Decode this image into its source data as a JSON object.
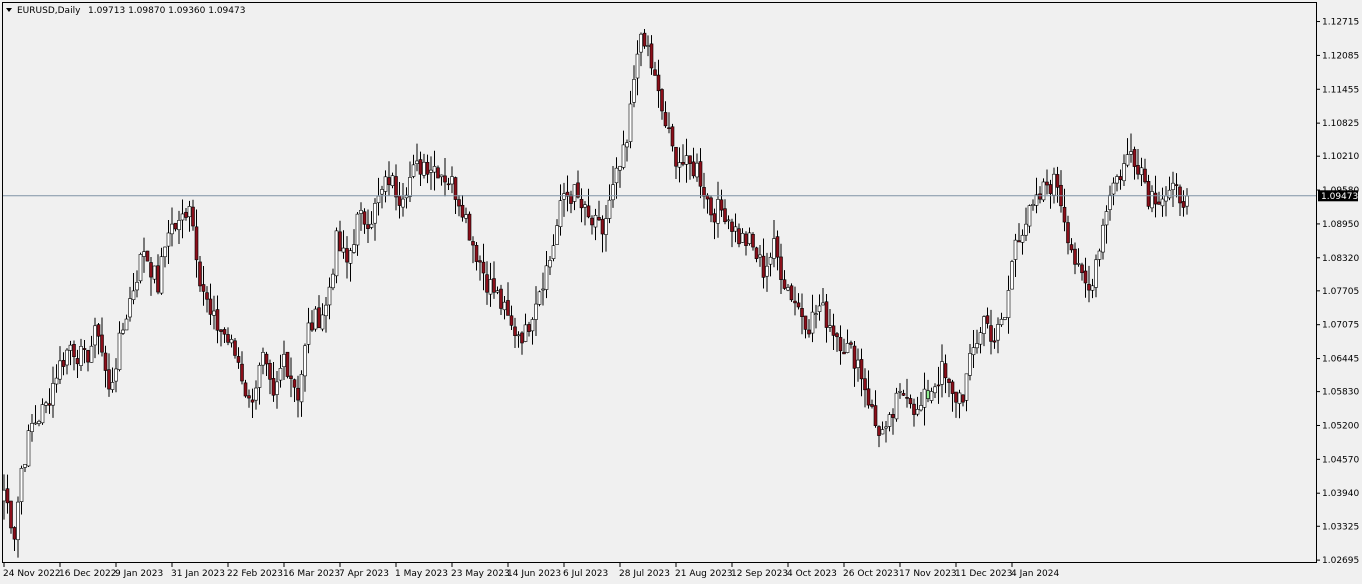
{
  "header": {
    "symbol_label": "EURUSD,Daily",
    "ohlc_label": "1.09713 1.09870 1.09360 1.09473",
    "menu_icon": "triangle-down-icon"
  },
  "price_label": "1.09473",
  "colors": {
    "background": "#f0f0f0",
    "border": "#000000",
    "up_body": "#ffffff",
    "down_body": "#8b0f1a",
    "highlight_up": "#90ee90",
    "candle_outline": "#000000",
    "price_line": "#7f93a5",
    "price_label_bg": "#000000",
    "price_label_text": "#ffffff"
  },
  "chart_data": {
    "type": "candlestick",
    "title": "EURUSD,Daily",
    "ylim": [
      1.0266,
      1.1306
    ],
    "grid": false,
    "y_ticks": [
      "1.12715",
      "1.12085",
      "1.11455",
      "1.10825",
      "1.10210",
      "1.09580",
      "1.08950",
      "1.08320",
      "1.07705",
      "1.07075",
      "1.06445",
      "1.05830",
      "1.05200",
      "1.04570",
      "1.03940",
      "1.03325",
      "1.02695"
    ],
    "x_ticks": [
      "24 Nov 2022",
      "16 Dec 2022",
      "9 Jan 2023",
      "31 Jan 2023",
      "22 Feb 2023",
      "16 Mar 2023",
      "7 Apr 2023",
      "1 May 2023",
      "23 May 2023",
      "14 Jun 2023",
      "6 Jul 2023",
      "28 Jul 2023",
      "21 Aug 2023",
      "12 Sep 2023",
      "4 Oct 2023",
      "26 Oct 2023",
      "17 Nov 2023",
      "11 Dec 2023",
      "4 Jan 2024"
    ],
    "current_price": 1.09473,
    "anchors": [
      [
        0,
        1.04
      ],
      [
        3,
        1.032
      ],
      [
        5,
        1.044
      ],
      [
        8,
        1.052
      ],
      [
        12,
        1.0555
      ],
      [
        15,
        1.062
      ],
      [
        19,
        1.067
      ],
      [
        23,
        1.064
      ],
      [
        27,
        1.07
      ],
      [
        30,
        1.058
      ],
      [
        35,
        1.073
      ],
      [
        40,
        1.085
      ],
      [
        44,
        1.078
      ],
      [
        47,
        1.089
      ],
      [
        50,
        1.089
      ],
      [
        53,
        1.094
      ],
      [
        56,
        1.08
      ],
      [
        59,
        1.072
      ],
      [
        63,
        1.069
      ],
      [
        67,
        1.064
      ],
      [
        70,
        1.056
      ],
      [
        74,
        1.064
      ],
      [
        77,
        1.056
      ],
      [
        80,
        1.065
      ],
      [
        84,
        1.058
      ],
      [
        87,
        1.07
      ],
      [
        92,
        1.074
      ],
      [
        95,
        1.086
      ],
      [
        98,
        1.082
      ],
      [
        101,
        1.09
      ],
      [
        105,
        1.091
      ],
      [
        110,
        1.098
      ],
      [
        113,
        1.095
      ],
      [
        117,
        1.099
      ],
      [
        120,
        1.101
      ],
      [
        124,
        1.1
      ],
      [
        128,
        1.097
      ],
      [
        131,
        1.093
      ],
      [
        134,
        1.086
      ],
      [
        138,
        1.079
      ],
      [
        141,
        1.076
      ],
      [
        145,
        1.07
      ],
      [
        149,
        1.069
      ],
      [
        152,
        1.076
      ],
      [
        156,
        1.083
      ],
      [
        160,
        1.095
      ],
      [
        163,
        1.095
      ],
      [
        167,
        1.09
      ],
      [
        171,
        1.088
      ],
      [
        175,
        1.098
      ],
      [
        178,
        1.104
      ],
      [
        181,
        1.123
      ],
      [
        184,
        1.122
      ],
      [
        187,
        1.113
      ],
      [
        191,
        1.103
      ],
      [
        195,
        1.1
      ],
      [
        198,
        1.1
      ],
      [
        202,
        1.092
      ],
      [
        206,
        1.092
      ],
      [
        210,
        1.087
      ],
      [
        213,
        1.086
      ],
      [
        217,
        1.081
      ],
      [
        220,
        1.085
      ],
      [
        223,
        1.079
      ],
      [
        227,
        1.074
      ],
      [
        230,
        1.071
      ],
      [
        233,
        1.074
      ],
      [
        236,
        1.071
      ],
      [
        240,
        1.067
      ],
      [
        244,
        1.064
      ],
      [
        247,
        1.057
      ],
      [
        249,
        1.052
      ],
      [
        252,
        1.05
      ],
      [
        255,
        1.056
      ],
      [
        258,
        1.059
      ],
      [
        261,
        1.054
      ],
      [
        264,
        1.058
      ],
      [
        268,
        1.062
      ],
      [
        271,
        1.057
      ],
      [
        274,
        1.058
      ],
      [
        277,
        1.066
      ],
      [
        280,
        1.072
      ],
      [
        283,
        1.068
      ],
      [
        286,
        1.072
      ],
      [
        289,
        1.087
      ],
      [
        292,
        1.09
      ],
      [
        295,
        1.093
      ],
      [
        298,
        1.097
      ],
      [
        301,
        1.097
      ],
      [
        304,
        1.088
      ],
      [
        307,
        1.08
      ],
      [
        310,
        1.077
      ],
      [
        313,
        1.086
      ],
      [
        316,
        1.096
      ],
      [
        319,
        1.099
      ],
      [
        322,
        1.103
      ],
      [
        325,
        1.1
      ],
      [
        327,
        1.095
      ],
      [
        329,
        1.095
      ],
      [
        332,
        1.095
      ],
      [
        335,
        1.095
      ],
      [
        338,
        1.0947
      ]
    ],
    "candle_count": 339,
    "highlight_candle_index": 264
  }
}
